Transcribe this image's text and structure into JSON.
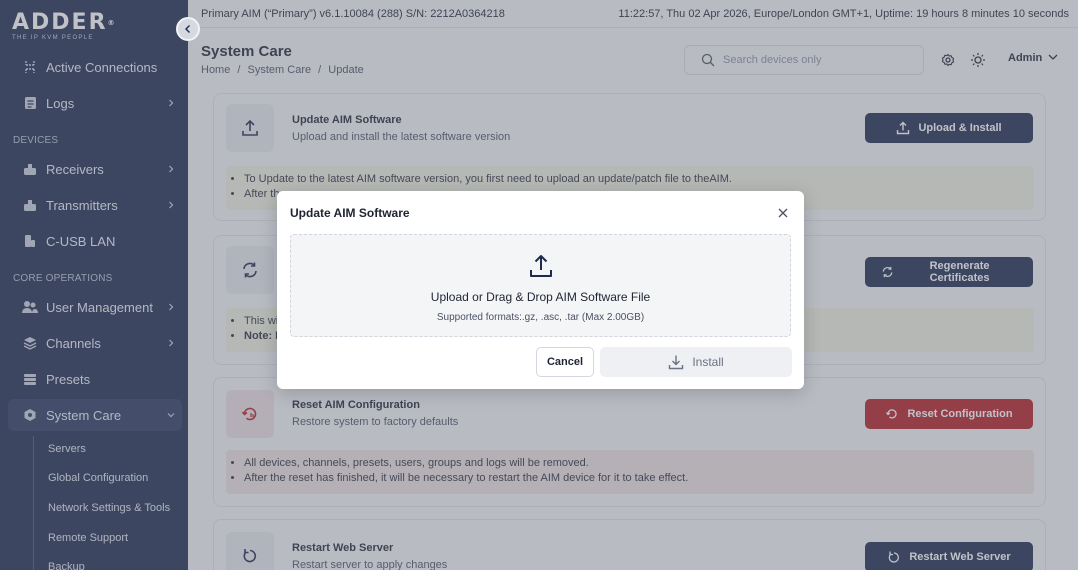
{
  "brand": {
    "name": "ADDER",
    "tagline": "THE IP KVM PEOPLE"
  },
  "topbar": {
    "device_info": "Primary AIM (“Primary”) v6.1.10084 (288) S/N: 2212A0364218",
    "status_info": "11:22:57, Thu 02 Apr 2026, Europe/London GMT+1, Uptime: 19 hours 8 minutes 10 seconds"
  },
  "sidebar": {
    "items": [
      {
        "label": "Active Connections",
        "icon": "connections-icon"
      },
      {
        "label": "Logs",
        "icon": "logs-icon"
      },
      {
        "label": "Receivers",
        "icon": "receiver-icon"
      },
      {
        "label": "Transmitters",
        "icon": "transmitter-icon"
      },
      {
        "label": "C-USB LAN",
        "icon": "usb-icon"
      },
      {
        "label": "User Management",
        "icon": "users-icon"
      },
      {
        "label": "Channels",
        "icon": "channels-icon"
      },
      {
        "label": "Presets",
        "icon": "presets-icon"
      },
      {
        "label": "System Care",
        "icon": "system-care-icon"
      }
    ],
    "sections": {
      "devices": "DEVICES",
      "core_operations": "CORE OPERATIONS"
    },
    "sub_items": [
      "Servers",
      "Global Configuration",
      "Network Settings & Tools",
      "Remote Support",
      "Backup"
    ]
  },
  "header": {
    "title": "System Care",
    "breadcrumb": [
      "Home",
      "/",
      "System Care",
      "/",
      "Update"
    ],
    "search_placeholder": "Search devices only",
    "user": "Admin"
  },
  "cards": {
    "update": {
      "title": "Update AIM Software",
      "subtitle": "Upload and install the latest software version",
      "button": "Upload & Install",
      "notes": [
        "To Update to the latest AIM software version, you first need to upload an update/patch file to theAIM.",
        "After th"
      ]
    },
    "certs": {
      "button": "Regenerate Certificates",
      "note_1": "This wi",
      "note_2": "Note: I"
    },
    "reset": {
      "title": "Reset AIM Configuration",
      "subtitle": "Restore system to factory defaults",
      "button": "Reset Configuration",
      "notes": [
        "All devices, channels, presets, users, groups and logs will be removed.",
        "After the reset has finished, it will be necessary to restart the AIM device for it to take effect."
      ]
    },
    "restart": {
      "title": "Restart Web Server",
      "subtitle": "Restart server to apply changes",
      "button": "Restart Web Server"
    }
  },
  "modal": {
    "title": "Update AIM Software",
    "drop_text": "Upload or Drag & Drop AIM Software File",
    "formats": "Supported formats:.gz, .asc, .tar (Max 2.00GB)",
    "cancel": "Cancel",
    "install": "Install"
  },
  "colors": {
    "sidebar": "#1e2a4f",
    "primary_button": "#1e2a4f",
    "danger_button": "#b41d24"
  }
}
